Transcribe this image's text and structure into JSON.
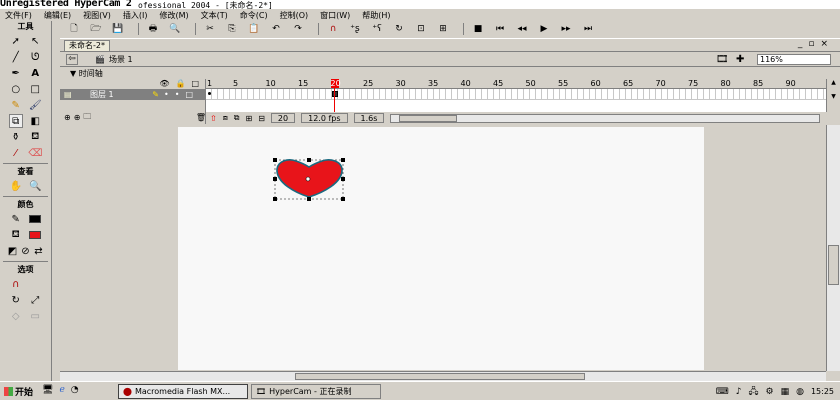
{
  "title": {
    "main": "Unregistered HyperCam 2",
    "rest": "ofessional 2004 - [未命名-2*]"
  },
  "menu": [
    "文件(F)",
    "编辑(E)",
    "视图(V)",
    "插入(I)",
    "修改(M)",
    "文本(T)",
    "命令(C)",
    "控制(O)",
    "窗口(W)",
    "帮助(H)"
  ],
  "toolbox": {
    "header": "工具",
    "view_header": "查看",
    "color_header": "颜色",
    "options_header": "选项",
    "colors": {
      "stroke": "#000000",
      "fill": "#e8141a"
    }
  },
  "document": {
    "tab": "未命名-2*",
    "scene": "场景 1",
    "zoom": "116%"
  },
  "timeline": {
    "header": "时间轴",
    "layer": "图层 1",
    "ruler": [
      "1",
      "5",
      "10",
      "15",
      "20",
      "25",
      "30",
      "35",
      "40",
      "45",
      "50",
      "55",
      "60",
      "65",
      "70",
      "75",
      "80",
      "85",
      "90"
    ],
    "current_frame": "20",
    "fps": "12.0 fps",
    "time": "1.6s"
  },
  "taskbar": {
    "start": "开始",
    "tasks": [
      "Macromedia Flash MX...",
      "HyperCam - 正在录制"
    ],
    "clock": "15:25"
  }
}
